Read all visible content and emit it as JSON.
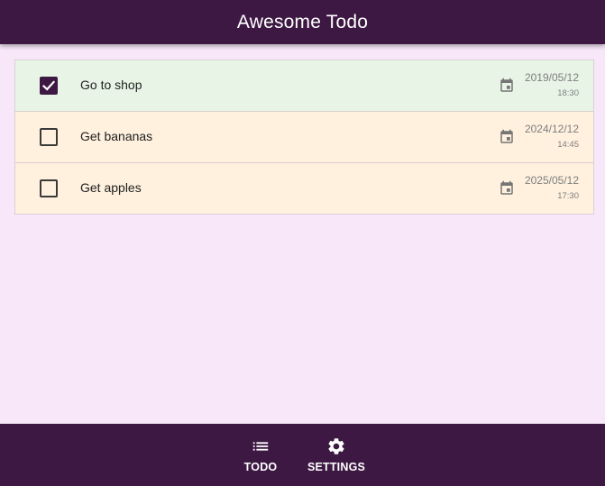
{
  "app": {
    "title": "Awesome Todo"
  },
  "todos": [
    {
      "text": "Go to shop",
      "date": "2019/05/12",
      "time": "18:30",
      "completed": true
    },
    {
      "text": "Get bananas",
      "date": "2024/12/12",
      "time": "14:45",
      "completed": false
    },
    {
      "text": "Get apples",
      "date": "2025/05/12",
      "time": "17:30",
      "completed": false
    }
  ],
  "icons": {
    "date": "calendar-icon",
    "todo_tab": "list-icon",
    "settings_tab": "gear-icon",
    "checkbox": "check-icon"
  },
  "nav": {
    "todo_label": "TODO",
    "settings_label": "SETTINGS"
  },
  "colors": {
    "primary": "#3d1843",
    "background": "#f7e7f8",
    "completed_row": "#e8f5e6",
    "pending_row": "#fff1de"
  }
}
